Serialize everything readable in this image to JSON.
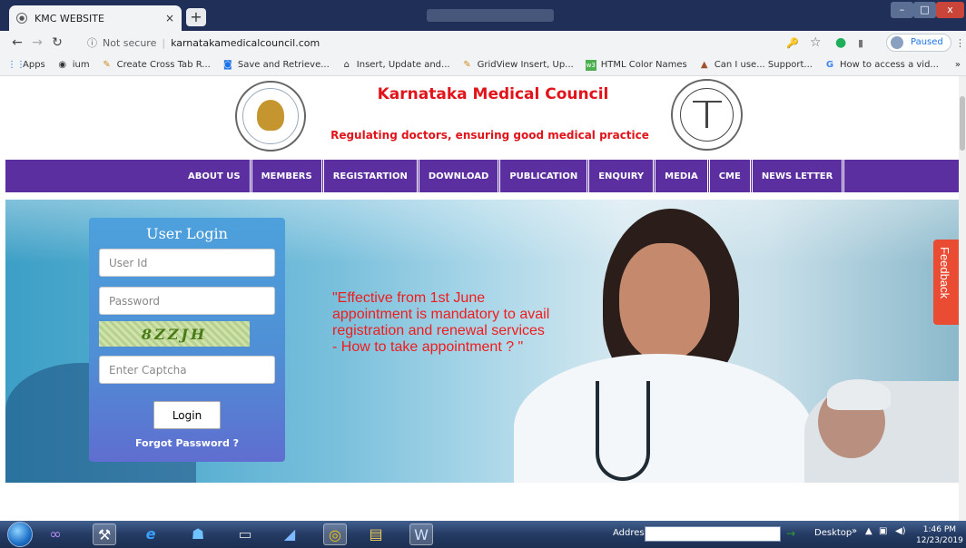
{
  "browser": {
    "tab_title": "KMC WEBSITE",
    "tab_close": "×",
    "new_tab": "+",
    "not_secure": "Not secure",
    "separator": "|",
    "url": "karnatakamedicalcouncil.com",
    "paused_label": "Paused",
    "window_min": "–",
    "window_max": "□",
    "window_close": "x"
  },
  "bookmarks": [
    {
      "label": "Apps",
      "icon": "apps-grid-icon"
    },
    {
      "label": "ium",
      "icon": "globe-icon"
    },
    {
      "label": "Create Cross Tab R...",
      "icon": "aspsnippets-icon"
    },
    {
      "label": "Save and Retrieve...",
      "icon": "bookmark-icon"
    },
    {
      "label": "Insert, Update and...",
      "icon": "page-icon"
    },
    {
      "label": "GridView Insert, Up...",
      "icon": "aspsnippets-icon"
    },
    {
      "label": "HTML Color Names",
      "icon": "w3-icon"
    },
    {
      "label": "Can I use... Support...",
      "icon": "caniuse-icon"
    },
    {
      "label": "How to access a vid...",
      "icon": "google-icon"
    }
  ],
  "bookmarks_overflow": "»",
  "site": {
    "title": "Karnataka Medical Council",
    "tagline": "Regulating doctors, ensuring good medical practice",
    "menu": [
      "ABOUT US",
      "MEMBERS",
      "REGISTARTION",
      "DOWNLOAD",
      "PUBLICATION",
      "ENQUIRY",
      "MEDIA",
      "CME",
      "NEWS LETTER"
    ],
    "notice": "\"Effective from 1st June appointment is mandatory to avail registration and renewal services - How to take appointment ? \"",
    "feedback": "Feedback"
  },
  "login": {
    "heading": "User Login",
    "userid_placeholder": "User Id",
    "password_placeholder": "Password",
    "captcha_text": "8ZZJH",
    "captcha_placeholder": "Enter Captcha",
    "button": "Login",
    "forgot": "Forgot Password ?"
  },
  "taskbar": {
    "address_label": "Address",
    "desktop_label": "Desktop",
    "time": "1:46 PM",
    "date": "12/23/2019",
    "overflow": "»"
  },
  "colors": {
    "menu_bg": "#5b2fa0",
    "title_red": "#e0141a",
    "notice_red": "#ef1c1c",
    "feedback_bg": "#ea4b33",
    "login_top": "#4da1dc"
  }
}
